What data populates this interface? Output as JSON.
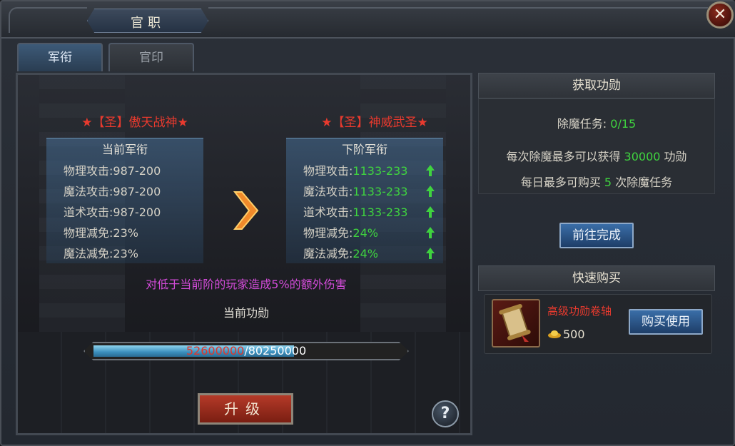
{
  "window": {
    "title": "官职",
    "close_label": "✕"
  },
  "tabs": [
    {
      "label": "军衔",
      "active": true
    },
    {
      "label": "官印",
      "active": false
    }
  ],
  "current_rank": {
    "title": "★【圣】傲天战神★",
    "box_header": "当前军衔",
    "stats": [
      {
        "label": "物理攻击:",
        "value": "987-200"
      },
      {
        "label": "魔法攻击:",
        "value": "987-200"
      },
      {
        "label": "道术攻击:",
        "value": "987-200"
      },
      {
        "label": "物理减免:",
        "value": "23%"
      },
      {
        "label": "魔法减免:",
        "value": "23%"
      }
    ]
  },
  "next_rank": {
    "title": "★【圣】神威武圣★",
    "box_header": "下阶军衔",
    "stats": [
      {
        "label": "物理攻击:",
        "value": "1133-233"
      },
      {
        "label": "魔法攻击:",
        "value": "1133-233"
      },
      {
        "label": "道术攻击:",
        "value": "1133-233"
      },
      {
        "label": "物理减免:",
        "value": "24%"
      },
      {
        "label": "魔法减免:",
        "value": "24%"
      }
    ]
  },
  "extra_damage_text": "对低于当前阶的玩家造成5%的额外伤害",
  "merit": {
    "label": "当前功勋",
    "current": "52600000",
    "separator": "/",
    "max": "80250000",
    "progress": 0.6554
  },
  "upgrade_label": "升级",
  "help_label": "?",
  "obtain_merit": {
    "header": "获取功勋",
    "task_label": "除魔任务: ",
    "task_value": "0/15",
    "line1_pre": "每次除魔最多可以获得 ",
    "line1_val": "30000",
    "line1_post": " 功勋",
    "line2_pre": "每日最多可购买 ",
    "line2_val": "5",
    "line2_post": " 次除魔任务",
    "go_button": "前往完成"
  },
  "quick_buy": {
    "header": "快速购买",
    "item_name": "高级功勋卷轴",
    "price": "500",
    "buy_button": "购买使用"
  },
  "colors": {
    "rank_red": "#e83a2e",
    "stat_green": "#3fd33f",
    "purple_text": "#d24bd8"
  },
  "icons": [
    "close-icon",
    "arrow-right-icon",
    "up-arrow-icon",
    "help-icon",
    "scroll-icon",
    "gold-ingot-icon"
  ]
}
